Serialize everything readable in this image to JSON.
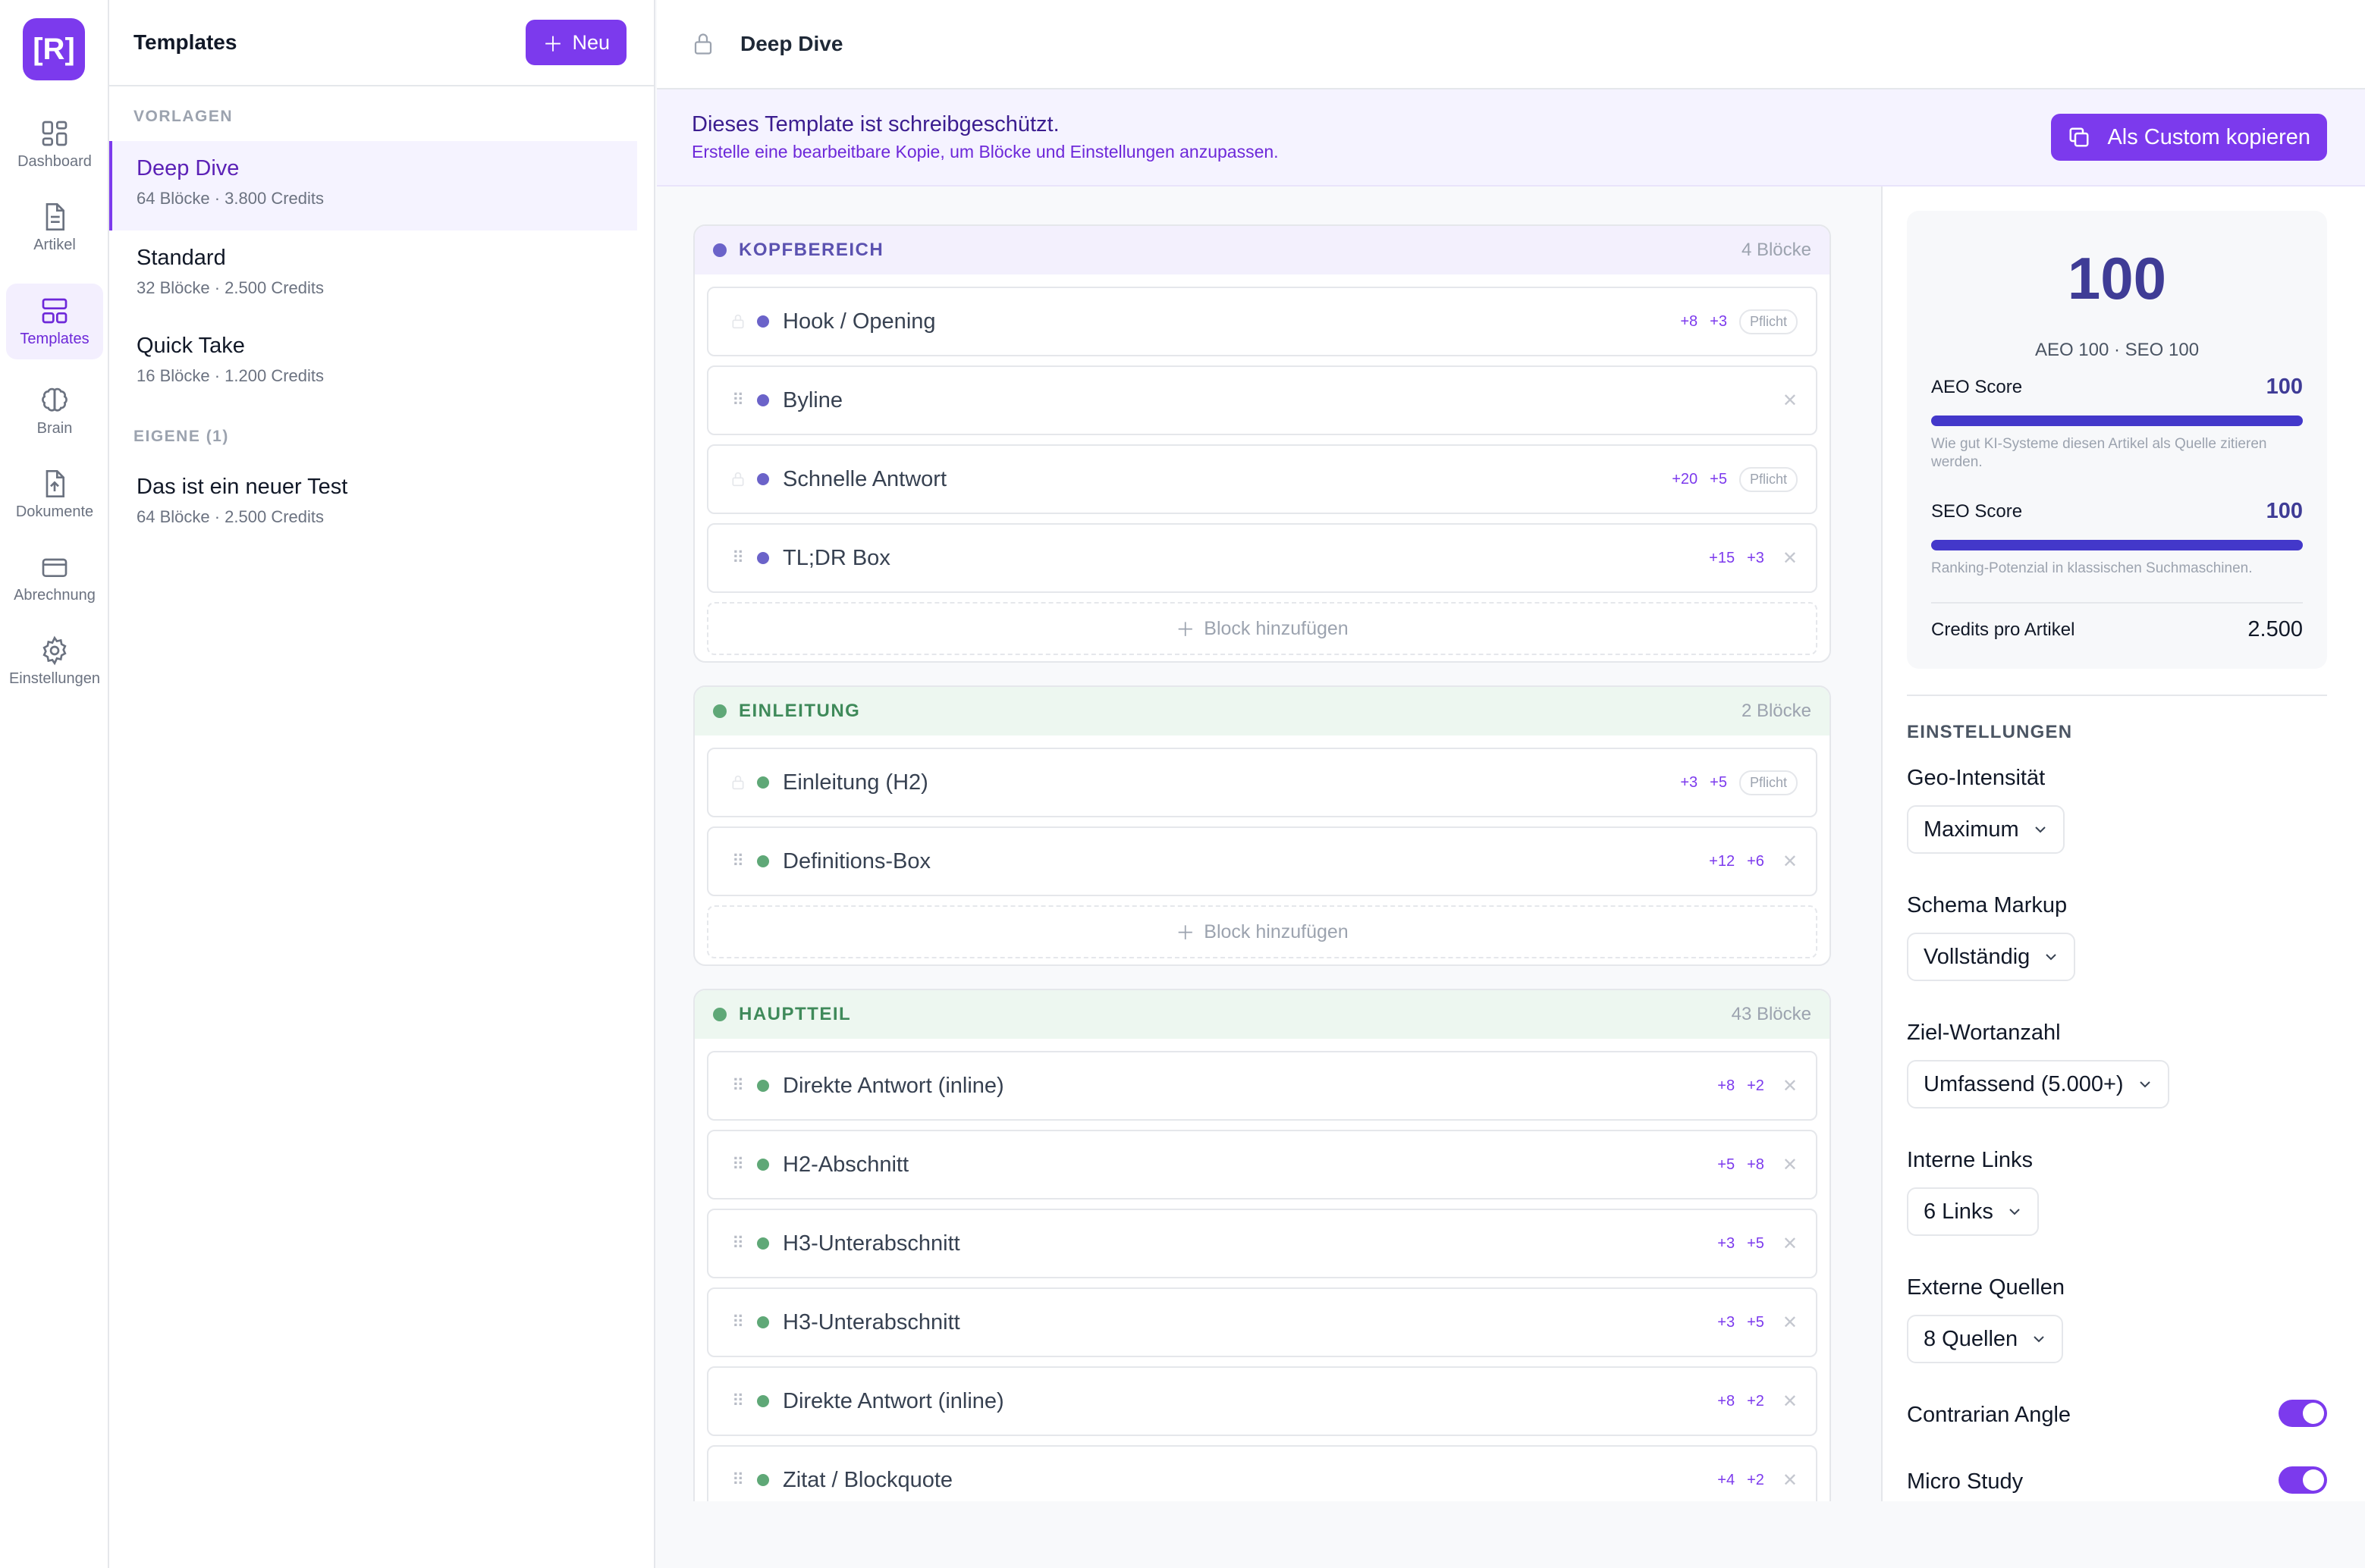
{
  "app": {
    "logo_text": "[R]"
  },
  "nav": [
    {
      "label": "Dashboard",
      "icon": "dashboard-icon"
    },
    {
      "label": "Artikel",
      "icon": "document-icon"
    },
    {
      "label": "Templates",
      "icon": "templates-icon",
      "active": true
    },
    {
      "label": "Brain",
      "icon": "brain-icon"
    },
    {
      "label": "Dokumente",
      "icon": "file-upload-icon"
    },
    {
      "label": "Abrechnung",
      "icon": "credit-card-icon"
    },
    {
      "label": "Einstellungen",
      "icon": "gear-icon"
    }
  ],
  "templates_panel": {
    "title": "Templates",
    "new_button": "Neu",
    "section_vorlagen": "VORLAGEN",
    "section_eigene": "EIGENE (1)",
    "items": [
      {
        "name": "Deep Dive",
        "meta": "64 Blöcke  ·  3.800 Credits"
      },
      {
        "name": "Standard",
        "meta": "32 Blöcke  ·  2.500 Credits"
      },
      {
        "name": "Quick Take",
        "meta": "16 Blöcke  ·  1.200 Credits"
      },
      {
        "name": "Das ist ein neuer Test",
        "meta": "64 Blöcke  ·  2.500 Credits"
      }
    ]
  },
  "editor": {
    "title": "Deep Dive",
    "banner_title": "Dieses Template ist schreibgeschützt.",
    "banner_text": "Erstelle eine bearbeitbare Kopie, um Blöcke und Einstellungen anzupassen.",
    "copy_button": "Als Custom kopieren",
    "add_block": "Block hinzufügen",
    "groups": [
      {
        "title": "KOPFBEREICH",
        "count": "4 Blöcke",
        "color": "#6b63c9",
        "head_bg": "#f3f0fd",
        "title_color": "#5b52b0",
        "blocks": [
          {
            "name": "Hook / Opening",
            "s1": "+8",
            "s2": "+3",
            "pflicht": "Pflicht"
          },
          {
            "name": "Byline"
          },
          {
            "name": "Schnelle Antwort",
            "s1": "+20",
            "s2": "+5",
            "pflicht": "Pflicht"
          },
          {
            "name": "TL;DR Box",
            "s1": "+15",
            "s2": "+3"
          }
        ]
      },
      {
        "title": "EINLEITUNG",
        "count": "2 Blöcke",
        "color": "#5fa877",
        "head_bg": "#edf7f0",
        "title_color": "#3f8a5a",
        "blocks": [
          {
            "name": "Einleitung (H2)",
            "s1": "+3",
            "s2": "+5",
            "pflicht": "Pflicht"
          },
          {
            "name": "Definitions-Box",
            "s1": "+12",
            "s2": "+6"
          }
        ]
      },
      {
        "title": "HAUPTTEIL",
        "count": "43 Blöcke",
        "color": "#5fa877",
        "head_bg": "#edf7f0",
        "title_color": "#3f8a5a",
        "blocks": [
          {
            "name": "Direkte Antwort (inline)",
            "s1": "+8",
            "s2": "+2"
          },
          {
            "name": "H2-Abschnitt",
            "s1": "+5",
            "s2": "+8"
          },
          {
            "name": "H3-Unterabschnitt",
            "s1": "+3",
            "s2": "+5"
          },
          {
            "name": "H3-Unterabschnitt",
            "s1": "+3",
            "s2": "+5"
          },
          {
            "name": "Direkte Antwort (inline)",
            "s1": "+8",
            "s2": "+2"
          },
          {
            "name": "Zitat / Blockquote",
            "s1": "+4",
            "s2": "+2"
          }
        ]
      }
    ]
  },
  "scores": {
    "total": "100",
    "subtitle": "AEO 100 · SEO 100",
    "aeo_label": "AEO Score",
    "aeo_value": "100",
    "aeo_fraction": 1.0,
    "aeo_hint": "Wie gut KI-Systeme diesen Artikel als Quelle zitieren werden.",
    "seo_label": "SEO Score",
    "seo_value": "100",
    "seo_fraction": 1.0,
    "seo_hint": "Ranking-Potenzial in klassischen Suchmaschinen.",
    "credits_label": "Credits pro Artikel",
    "credits_value": "2.500"
  },
  "settings": {
    "heading": "EINSTELLUNGEN",
    "geo_label": "Geo-Intensität",
    "geo_value": "Maximum",
    "schema_label": "Schema Markup",
    "schema_value": "Vollständig",
    "words_label": "Ziel-Wortanzahl",
    "words_value": "Umfassend (5.000+)",
    "links_label": "Interne Links",
    "links_value": "6 Links",
    "sources_label": "Externe Quellen",
    "sources_value": "8 Quellen",
    "contrarian_label": "Contrarian Angle",
    "contrarian_on": true,
    "micro_label": "Micro Study",
    "micro_on": true
  },
  "colors": {
    "accent": "#7c3aed",
    "score": "#3f3c96"
  }
}
